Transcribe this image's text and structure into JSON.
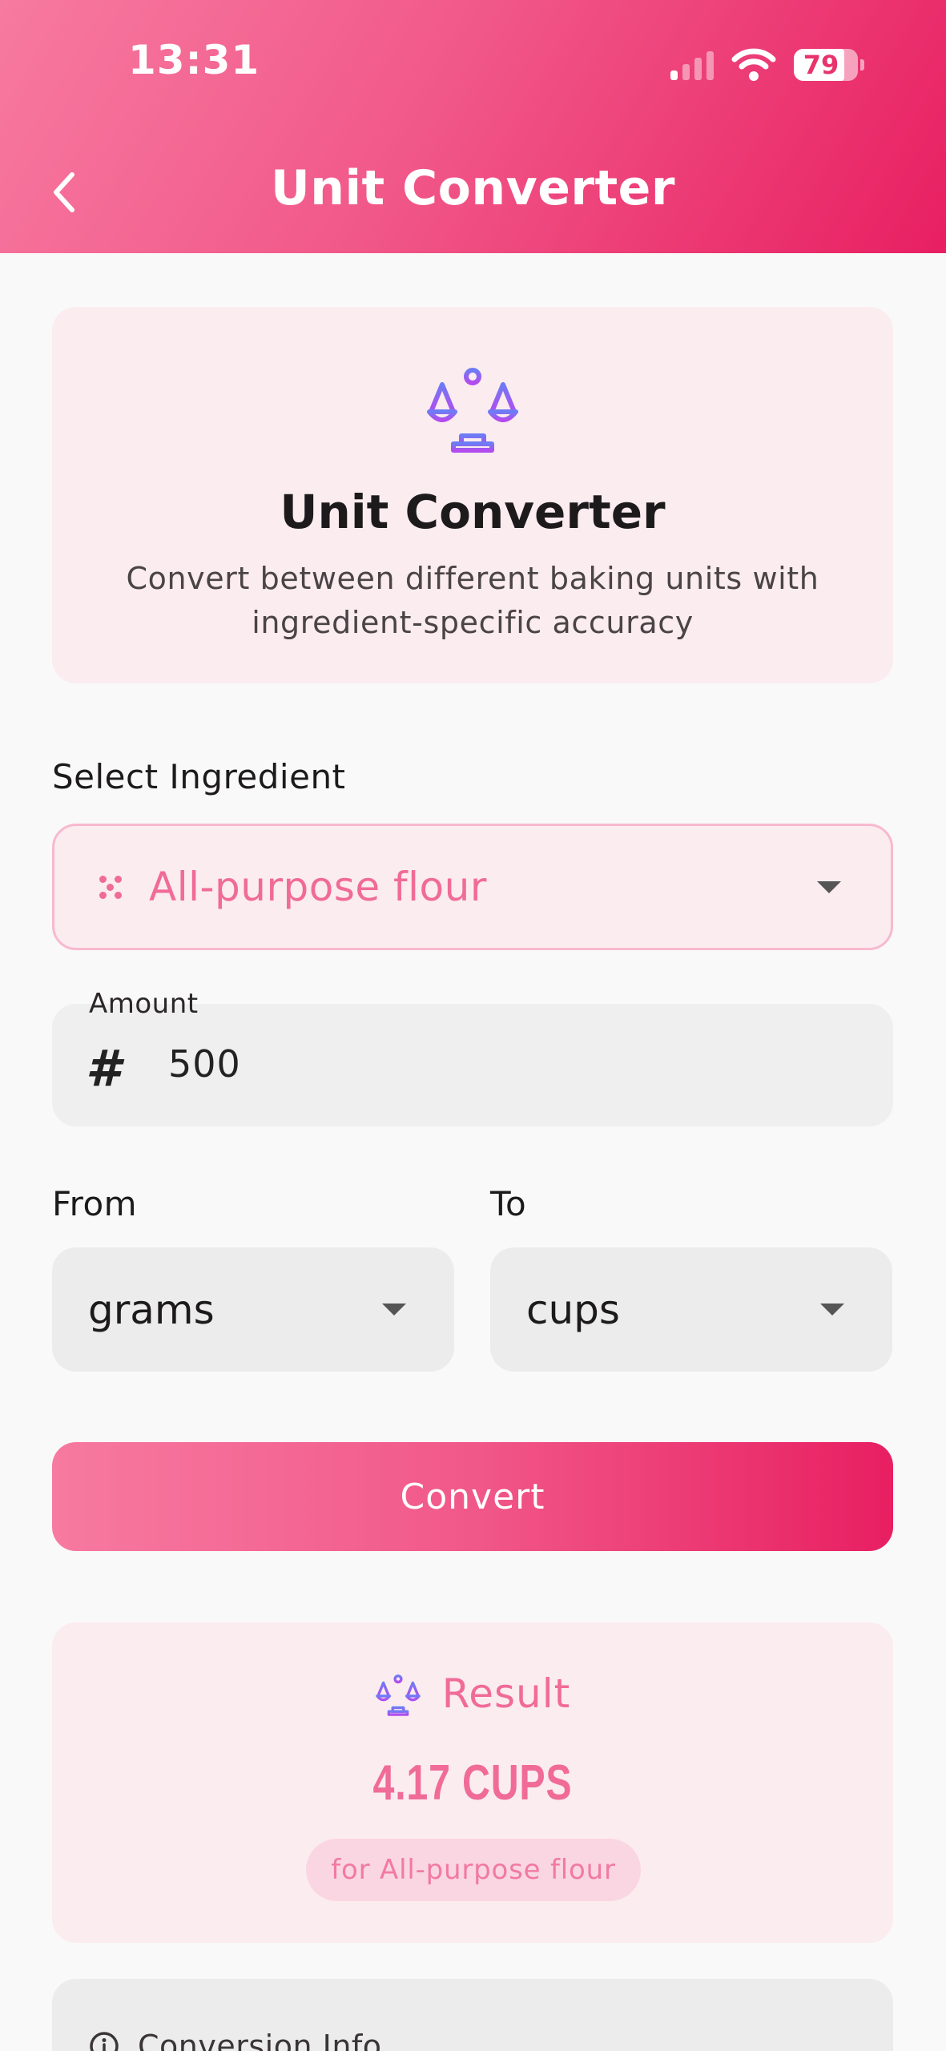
{
  "status_bar": {
    "time": "13:31",
    "battery": "79"
  },
  "header": {
    "title": "Unit Converter"
  },
  "intro": {
    "title": "Unit Converter",
    "description": "Convert between different baking units with ingredient-specific accuracy",
    "icon": "scale-icon"
  },
  "ingredient": {
    "label": "Select Ingredient",
    "value": "All-purpose flour"
  },
  "amount": {
    "label": "Amount",
    "value": "500"
  },
  "from": {
    "label": "From",
    "value": "grams"
  },
  "to": {
    "label": "To",
    "value": "cups"
  },
  "convert_button": {
    "label": "Convert"
  },
  "result": {
    "title": "Result",
    "value": "4.17 CUPS",
    "note": "for All-purpose flour"
  },
  "info": {
    "title": "Conversion Info"
  },
  "colors": {
    "accent": "#e81f62",
    "accent_light": "#f77aa0",
    "text_pink": "#f06b98",
    "card_pink": "#fbecf0"
  }
}
